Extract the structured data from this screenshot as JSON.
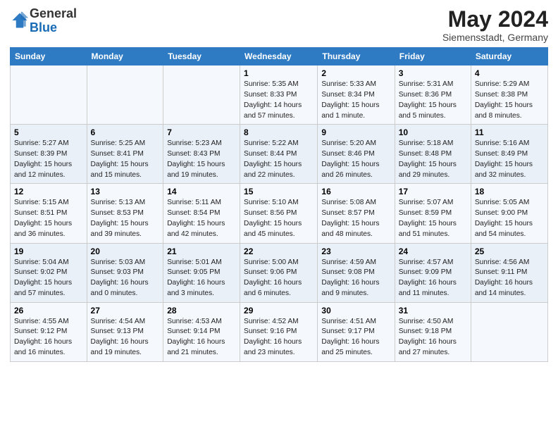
{
  "logo": {
    "general": "General",
    "blue": "Blue"
  },
  "title": "May 2024",
  "subtitle": "Siemensstadt, Germany",
  "days_of_week": [
    "Sunday",
    "Monday",
    "Tuesday",
    "Wednesday",
    "Thursday",
    "Friday",
    "Saturday"
  ],
  "weeks": [
    [
      {
        "num": "",
        "info": ""
      },
      {
        "num": "",
        "info": ""
      },
      {
        "num": "",
        "info": ""
      },
      {
        "num": "1",
        "info": "Sunrise: 5:35 AM\nSunset: 8:33 PM\nDaylight: 14 hours\nand 57 minutes."
      },
      {
        "num": "2",
        "info": "Sunrise: 5:33 AM\nSunset: 8:34 PM\nDaylight: 15 hours\nand 1 minute."
      },
      {
        "num": "3",
        "info": "Sunrise: 5:31 AM\nSunset: 8:36 PM\nDaylight: 15 hours\nand 5 minutes."
      },
      {
        "num": "4",
        "info": "Sunrise: 5:29 AM\nSunset: 8:38 PM\nDaylight: 15 hours\nand 8 minutes."
      }
    ],
    [
      {
        "num": "5",
        "info": "Sunrise: 5:27 AM\nSunset: 8:39 PM\nDaylight: 15 hours\nand 12 minutes."
      },
      {
        "num": "6",
        "info": "Sunrise: 5:25 AM\nSunset: 8:41 PM\nDaylight: 15 hours\nand 15 minutes."
      },
      {
        "num": "7",
        "info": "Sunrise: 5:23 AM\nSunset: 8:43 PM\nDaylight: 15 hours\nand 19 minutes."
      },
      {
        "num": "8",
        "info": "Sunrise: 5:22 AM\nSunset: 8:44 PM\nDaylight: 15 hours\nand 22 minutes."
      },
      {
        "num": "9",
        "info": "Sunrise: 5:20 AM\nSunset: 8:46 PM\nDaylight: 15 hours\nand 26 minutes."
      },
      {
        "num": "10",
        "info": "Sunrise: 5:18 AM\nSunset: 8:48 PM\nDaylight: 15 hours\nand 29 minutes."
      },
      {
        "num": "11",
        "info": "Sunrise: 5:16 AM\nSunset: 8:49 PM\nDaylight: 15 hours\nand 32 minutes."
      }
    ],
    [
      {
        "num": "12",
        "info": "Sunrise: 5:15 AM\nSunset: 8:51 PM\nDaylight: 15 hours\nand 36 minutes."
      },
      {
        "num": "13",
        "info": "Sunrise: 5:13 AM\nSunset: 8:53 PM\nDaylight: 15 hours\nand 39 minutes."
      },
      {
        "num": "14",
        "info": "Sunrise: 5:11 AM\nSunset: 8:54 PM\nDaylight: 15 hours\nand 42 minutes."
      },
      {
        "num": "15",
        "info": "Sunrise: 5:10 AM\nSunset: 8:56 PM\nDaylight: 15 hours\nand 45 minutes."
      },
      {
        "num": "16",
        "info": "Sunrise: 5:08 AM\nSunset: 8:57 PM\nDaylight: 15 hours\nand 48 minutes."
      },
      {
        "num": "17",
        "info": "Sunrise: 5:07 AM\nSunset: 8:59 PM\nDaylight: 15 hours\nand 51 minutes."
      },
      {
        "num": "18",
        "info": "Sunrise: 5:05 AM\nSunset: 9:00 PM\nDaylight: 15 hours\nand 54 minutes."
      }
    ],
    [
      {
        "num": "19",
        "info": "Sunrise: 5:04 AM\nSunset: 9:02 PM\nDaylight: 15 hours\nand 57 minutes."
      },
      {
        "num": "20",
        "info": "Sunrise: 5:03 AM\nSunset: 9:03 PM\nDaylight: 16 hours\nand 0 minutes."
      },
      {
        "num": "21",
        "info": "Sunrise: 5:01 AM\nSunset: 9:05 PM\nDaylight: 16 hours\nand 3 minutes."
      },
      {
        "num": "22",
        "info": "Sunrise: 5:00 AM\nSunset: 9:06 PM\nDaylight: 16 hours\nand 6 minutes."
      },
      {
        "num": "23",
        "info": "Sunrise: 4:59 AM\nSunset: 9:08 PM\nDaylight: 16 hours\nand 9 minutes."
      },
      {
        "num": "24",
        "info": "Sunrise: 4:57 AM\nSunset: 9:09 PM\nDaylight: 16 hours\nand 11 minutes."
      },
      {
        "num": "25",
        "info": "Sunrise: 4:56 AM\nSunset: 9:11 PM\nDaylight: 16 hours\nand 14 minutes."
      }
    ],
    [
      {
        "num": "26",
        "info": "Sunrise: 4:55 AM\nSunset: 9:12 PM\nDaylight: 16 hours\nand 16 minutes."
      },
      {
        "num": "27",
        "info": "Sunrise: 4:54 AM\nSunset: 9:13 PM\nDaylight: 16 hours\nand 19 minutes."
      },
      {
        "num": "28",
        "info": "Sunrise: 4:53 AM\nSunset: 9:14 PM\nDaylight: 16 hours\nand 21 minutes."
      },
      {
        "num": "29",
        "info": "Sunrise: 4:52 AM\nSunset: 9:16 PM\nDaylight: 16 hours\nand 23 minutes."
      },
      {
        "num": "30",
        "info": "Sunrise: 4:51 AM\nSunset: 9:17 PM\nDaylight: 16 hours\nand 25 minutes."
      },
      {
        "num": "31",
        "info": "Sunrise: 4:50 AM\nSunset: 9:18 PM\nDaylight: 16 hours\nand 27 minutes."
      },
      {
        "num": "",
        "info": ""
      }
    ]
  ]
}
